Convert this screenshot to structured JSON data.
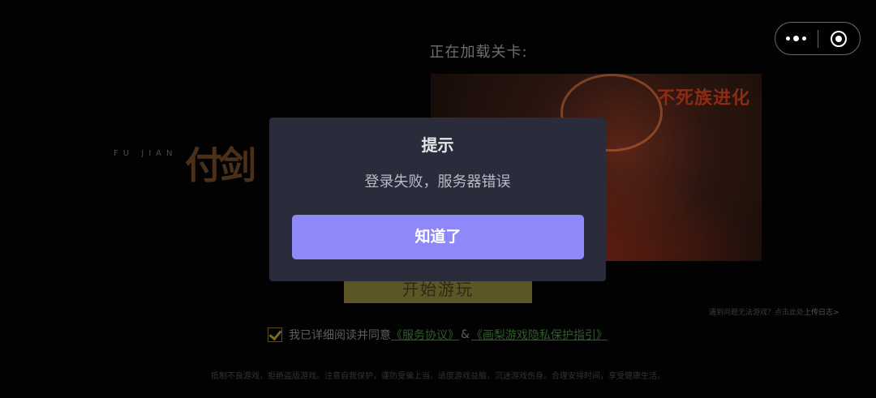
{
  "game": {
    "loading_title": "正在加载关卡:",
    "banner_title": "不死族进化",
    "logo_pinyin": "FU JIAN",
    "logo_cn": "付剑",
    "start_button": "开始游玩",
    "upload_prefix": "遇到问题无法游戏？点击此处",
    "upload_link": "上传日志>",
    "agree_prefix": "我已详细阅读并同意",
    "service_link": "《服务协议》",
    "amp": "&",
    "privacy_link": "《画梨游戏隐私保护指引》",
    "health_notice": "抵制不良游戏，拒绝盗版游戏。注意自我保护，谨防受骗上当。适度游戏益脑，沉迷游戏伤身。合理安排时间，享受健康生活。"
  },
  "capsule": {
    "more_icon": "more-dots-icon",
    "close_icon": "target-close-icon"
  },
  "dialog": {
    "title": "提示",
    "message": "登录失败，服务器错误",
    "confirm_label": "知道了"
  },
  "colors": {
    "dialog_bg": "#2b2c3b",
    "dialog_button": "#8f88f8"
  }
}
